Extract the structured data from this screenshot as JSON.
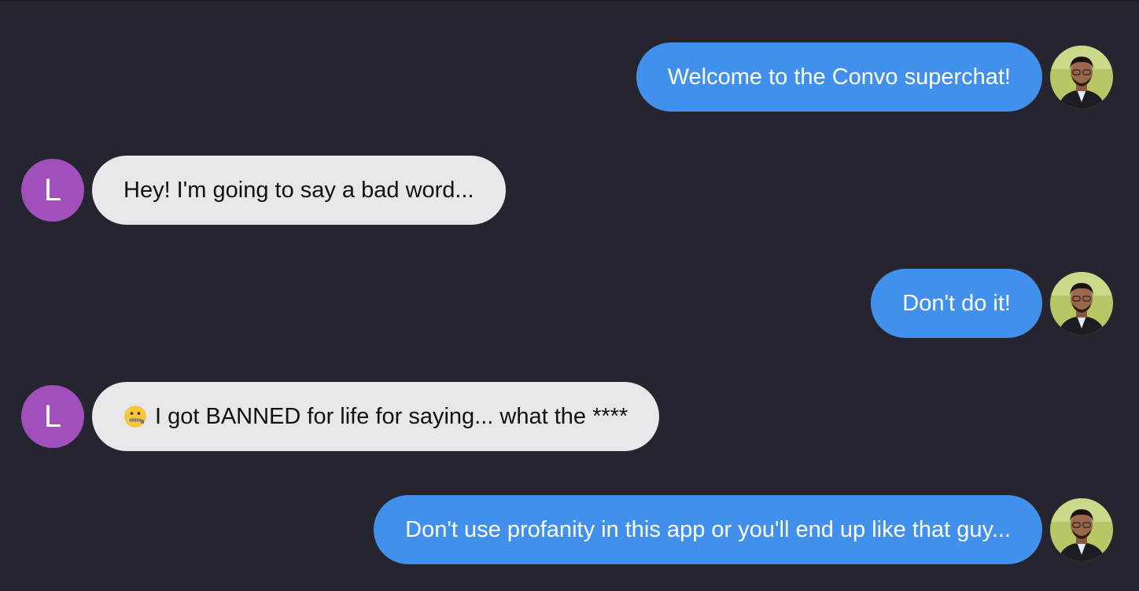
{
  "colors": {
    "background": "#26252f",
    "outgoing_bubble": "#4191ec",
    "incoming_bubble": "#e8e7ec",
    "incoming_avatar": "#a04fbd"
  },
  "incoming_user": {
    "initial": "L"
  },
  "messages": [
    {
      "direction": "outgoing",
      "text": "Welcome to the Convo superchat!",
      "avatar": "user-photo"
    },
    {
      "direction": "incoming",
      "text": "Hey! I'm going to say a bad word...",
      "avatar": "letter"
    },
    {
      "direction": "outgoing",
      "text": "Don't do it!",
      "avatar": "user-photo"
    },
    {
      "direction": "incoming",
      "emoji": "zipper-mouth-face-icon",
      "text": "I got BANNED for life for saying... what the ****",
      "avatar": "letter"
    },
    {
      "direction": "outgoing",
      "text": "Don't use profanity in this app or you'll end up like that guy...",
      "avatar": "user-photo"
    }
  ]
}
